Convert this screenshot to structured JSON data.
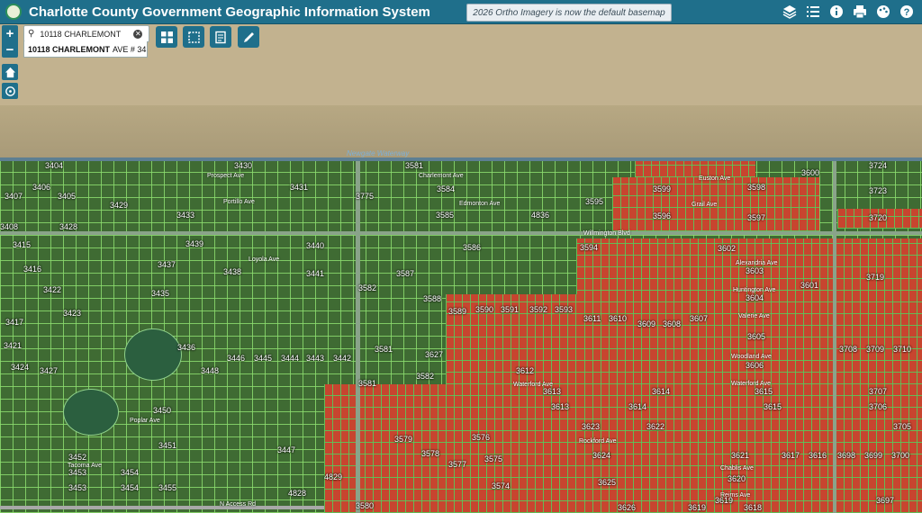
{
  "header": {
    "title": "Charlotte County Government Geographic Information System",
    "banner": "2026 Ortho Imagery is now the default basemap"
  },
  "search": {
    "value": "10118 CHARLEMONT",
    "result_bold": "10118 CHARLEMONT",
    "result_rest": "AVE # 34..."
  },
  "roads": {
    "newgate": "Newgate Waterway",
    "charlemont": "Charlemont Ave",
    "prospect": "Prospect Ave",
    "portillo": "Portillo Ave",
    "edmonton": "Edmonton Ave",
    "euston": "Euston Ave",
    "grail": "Grail Ave",
    "willmington": "Willmington Blvd",
    "loyola": "Loyola Ave",
    "alexandria": "Alexandria Ave",
    "huntington": "Huntington Ave",
    "valerie": "Valerie Ave",
    "woodland": "Woodland Ave",
    "waterford": "Waterford Ave",
    "poplar": "Poplar Ave",
    "rockford": "Rockford Ave",
    "chablis": "Chablis Ave",
    "reims": "Reims Ave",
    "tacoma": "Tacoma Ave",
    "access": "N Access Rd",
    "gulfstream": "Gulfstream Blvd"
  },
  "parcels": [
    "3404",
    "3430",
    "3581",
    "3724",
    "3406",
    "3431",
    "3584",
    "3599",
    "3598",
    "3600",
    "3723",
    "3407",
    "3405",
    "3429",
    "3775",
    "3595",
    "3585",
    "4836",
    "3596",
    "3597",
    "3720",
    "3433",
    "3408",
    "3428",
    "3439",
    "3440",
    "3586",
    "3594",
    "3602",
    "3415",
    "3437",
    "3438",
    "3587",
    "3603",
    "3719",
    "3416",
    "3441",
    "3604",
    "3422",
    "3435",
    "3582",
    "3588",
    "3589",
    "3590",
    "3591",
    "3592",
    "3593",
    "3601",
    "3423",
    "3611",
    "3610",
    "3609",
    "3608",
    "3607",
    "3417",
    "3436",
    "3581",
    "3627",
    "3605",
    "3708",
    "3709",
    "3710",
    "3421",
    "3446",
    "3445",
    "3444",
    "3443",
    "3442",
    "3606",
    "3424",
    "3427",
    "3448",
    "3612",
    "3581",
    "3582",
    "3613",
    "3614",
    "3615",
    "3707",
    "3450",
    "3613",
    "3614",
    "3615",
    "3706",
    "3623",
    "3622",
    "3705",
    "3451",
    "3579",
    "3576",
    "3624",
    "3621",
    "3617",
    "3616",
    "3698",
    "3699",
    "3700",
    "3452",
    "3447",
    "3578",
    "3575",
    "3620",
    "3453",
    "3454",
    "3577",
    "3574",
    "3625",
    "3619",
    "3697",
    "3453",
    "3454",
    "3455",
    "4829",
    "4828",
    "3580",
    "3626",
    "3619",
    "3618"
  ],
  "colors": {
    "header": "#1f6f8b",
    "highlight_parcels": "#c7452f",
    "parcel_lines": "#8cdc6e"
  },
  "icons": [
    "layers-icon",
    "list-icon",
    "info-icon",
    "print-icon",
    "palette-icon",
    "help-icon",
    "zoom-in-icon",
    "zoom-out-icon",
    "home-icon",
    "locate-icon",
    "grid-tool-icon",
    "select-tool-icon",
    "notes-tool-icon",
    "draw-tool-icon",
    "search-icon"
  ]
}
